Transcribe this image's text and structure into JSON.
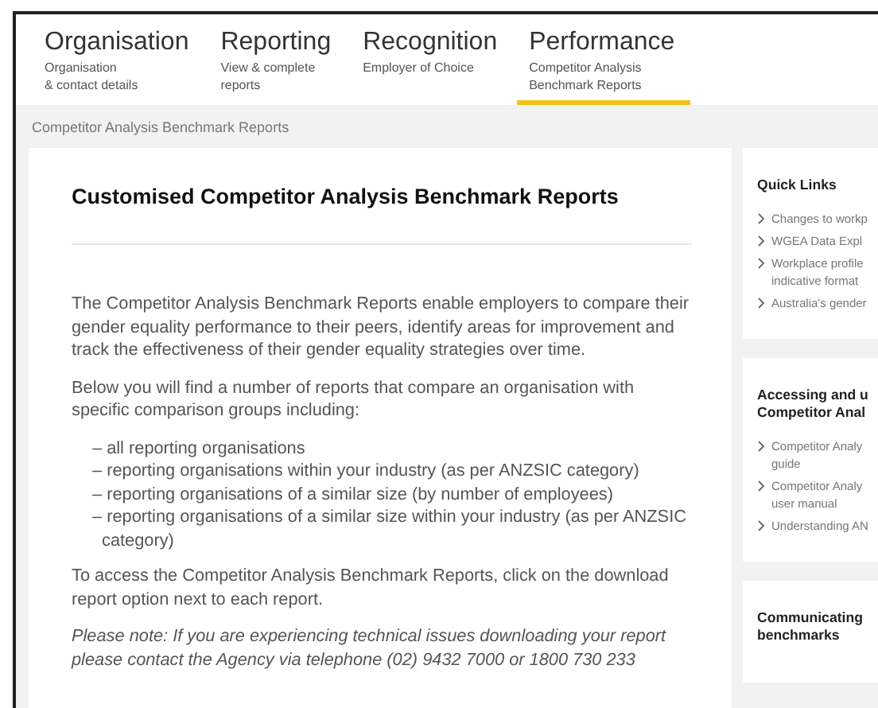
{
  "tabs": [
    {
      "title": "Organisation",
      "subtitle": "Organisation\n& contact details",
      "selected": false
    },
    {
      "title": "Reporting",
      "subtitle": "View & complete\nreports",
      "selected": false
    },
    {
      "title": "Recognition",
      "subtitle": "Employer of Choice",
      "selected": false
    },
    {
      "title": "Performance",
      "subtitle": "Competitor Analysis\nBenchmark Reports",
      "selected": true
    }
  ],
  "breadcrumb": "Competitor Analysis Benchmark Reports",
  "main": {
    "heading": "Customised Competitor Analysis Benchmark Reports",
    "intro": "The Competitor Analysis Benchmark Reports enable employers to compare their gender equality performance to their peers, identify areas for improvement and track the effectiveness of their gender equality strategies over time.",
    "lead": "Below you will find a number of reports that compare an organisation with specific comparison groups including:",
    "groups": [
      "– all reporting organisations",
      "– reporting organisations within your industry (as per ANZSIC category)",
      "– reporting organisations of a similar size (by number of employees)",
      "– reporting organisations of a similar size within your industry (as per ANZSIC category)"
    ],
    "access": "To access the Competitor Analysis Benchmark Reports, click on the download report option next to each report.",
    "note": "Please note: If you are experiencing technical issues downloading your report please contact the Agency via telephone (02) 9432 7000 or 1800 730 233"
  },
  "sidebar": [
    {
      "heading": "Quick Links",
      "links": [
        "Changes to workp",
        "WGEA Data Expl",
        "Workplace profile\nindicative format",
        "Australia's gender"
      ]
    },
    {
      "heading": "Accessing and u\nCompetitor Anal",
      "links": [
        "Competitor Analy\nguide",
        "Competitor Analy\nuser manual",
        "Understanding AN"
      ]
    },
    {
      "heading": "Communicating\nbenchmarks"
    }
  ]
}
